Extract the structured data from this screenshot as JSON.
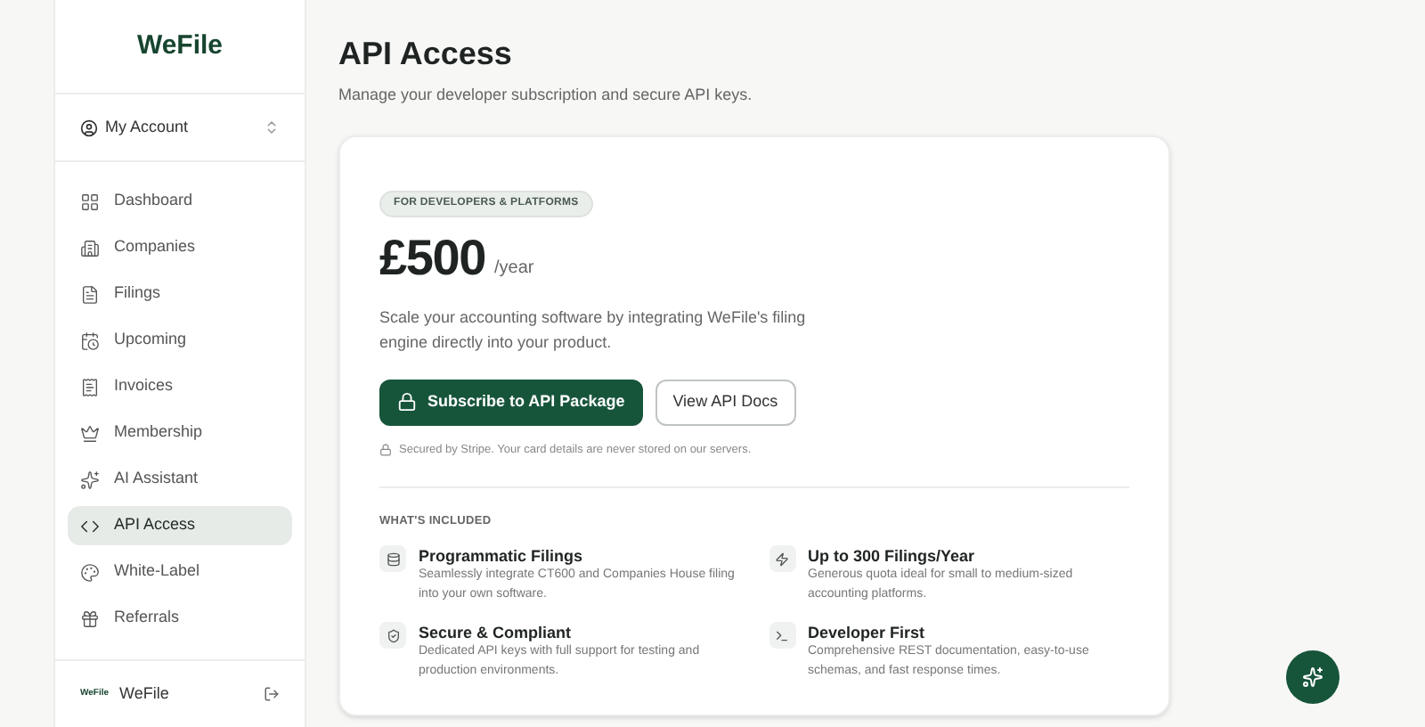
{
  "sidebar": {
    "logo": "WeFile",
    "account": "My Account",
    "items": [
      {
        "label": "Dashboard",
        "selected": false
      },
      {
        "label": "Companies",
        "selected": false
      },
      {
        "label": "Filings",
        "selected": false
      },
      {
        "label": "Upcoming",
        "selected": false
      },
      {
        "label": "Invoices",
        "selected": false
      },
      {
        "label": "Membership",
        "selected": false
      },
      {
        "label": "AI Assistant",
        "selected": false
      },
      {
        "label": "API Access",
        "selected": true
      },
      {
        "label": "White-Label",
        "selected": false
      },
      {
        "label": "Referrals",
        "selected": false
      }
    ],
    "footer": {
      "mini_logo": "WeFile",
      "name": "WeFile"
    }
  },
  "page": {
    "title": "API Access",
    "subtitle": "Manage your developer subscription and secure API keys."
  },
  "plan": {
    "badge": "FOR DEVELOPERS & PLATFORMS",
    "price": "£500",
    "period": "/year",
    "description": "Scale your accounting software by integrating WeFile's filing engine directly into your product.",
    "primary_button": "Subscribe to API Package",
    "secondary_button": "View API Docs",
    "security_note": "Secured by Stripe. Your card details are never stored on our servers.",
    "included_heading": "WHAT'S INCLUDED",
    "features": [
      {
        "title": "Programmatic Filings",
        "text": "Seamlessly integrate CT600 and Companies House filing into your own software."
      },
      {
        "title": "Up to 300 Filings/Year",
        "text": "Generous quota ideal for small to medium-sized accounting platforms."
      },
      {
        "title": "Secure & Compliant",
        "text": "Dedicated API keys with full support for testing and production environments."
      },
      {
        "title": "Developer First",
        "text": "Comprehensive REST documentation, easy-to-use schemas, and fast response times."
      }
    ]
  }
}
